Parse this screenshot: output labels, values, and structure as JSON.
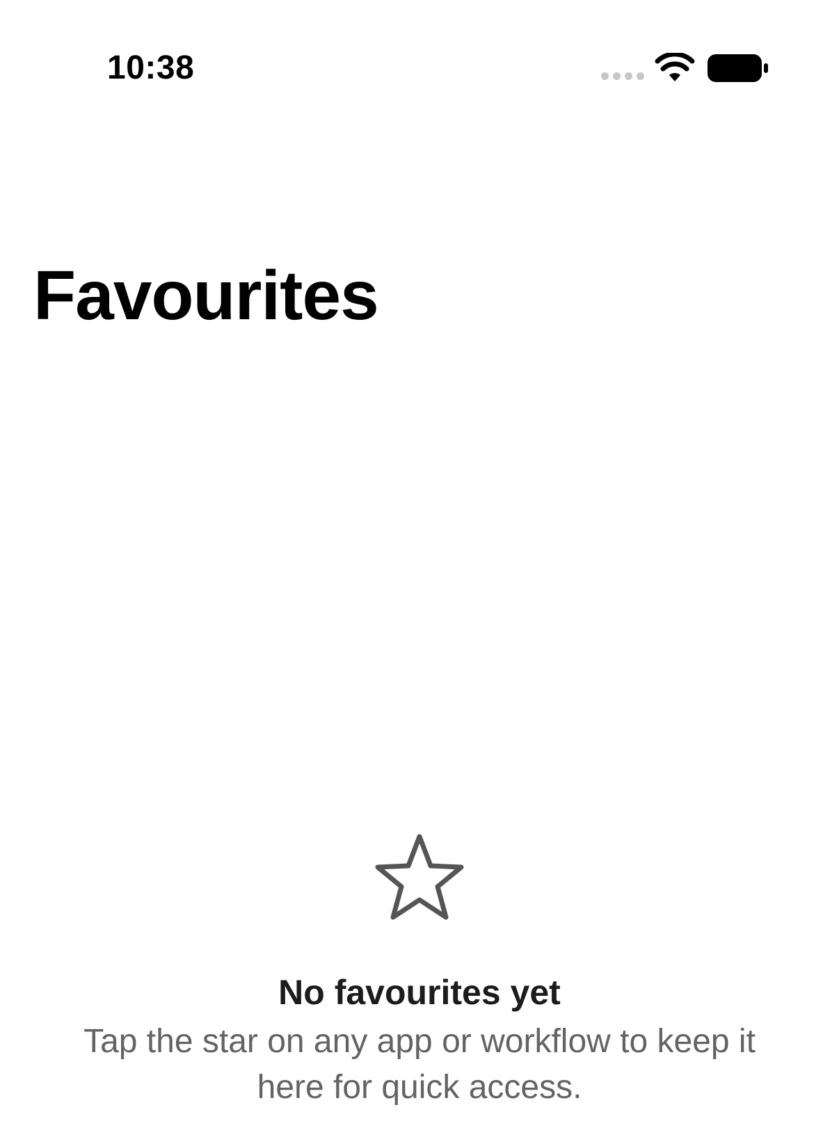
{
  "status_bar": {
    "time": "10:38"
  },
  "header": {
    "title": "Favourites"
  },
  "empty_state": {
    "icon": "star-outline-icon",
    "title": "No favourites yet",
    "description": "Tap the star on any app or workflow to keep it here for quick access."
  },
  "colors": {
    "icon_gray": "#555555",
    "secondary_text": "#636366"
  }
}
